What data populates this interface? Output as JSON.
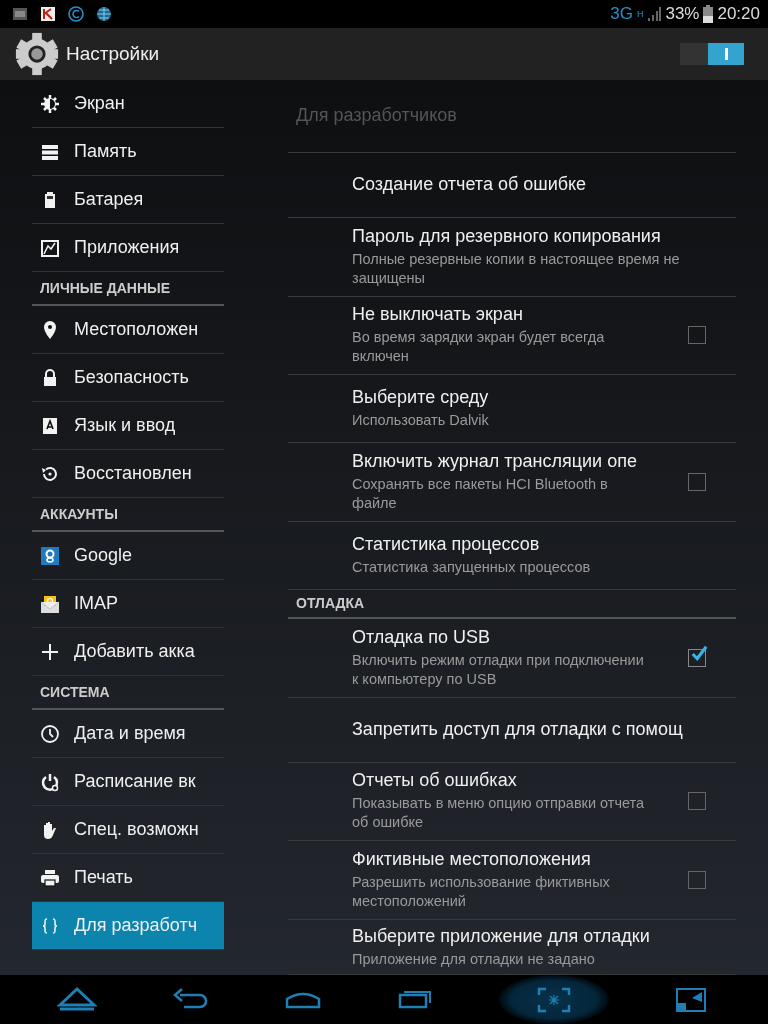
{
  "status_bar": {
    "network": "3G",
    "network_mode": "H",
    "battery": "33%",
    "time": "20:20"
  },
  "action_bar": {
    "title": "Настройки",
    "master_switch": {
      "on": true
    }
  },
  "sidebar": {
    "items": [
      {
        "kind": "item",
        "label": "Экран",
        "selected": false
      },
      {
        "kind": "item",
        "label": "Память",
        "selected": false
      },
      {
        "kind": "item",
        "label": "Батарея",
        "selected": false
      },
      {
        "kind": "item",
        "label": "Приложения",
        "selected": false
      },
      {
        "kind": "header",
        "label": "ЛИЧНЫЕ ДАННЫЕ"
      },
      {
        "kind": "item",
        "label": "Местоположен",
        "selected": false
      },
      {
        "kind": "item",
        "label": "Безопасность",
        "selected": false
      },
      {
        "kind": "item",
        "label": "Язык и ввод",
        "selected": false
      },
      {
        "kind": "item",
        "label": "Восстановлен",
        "selected": false
      },
      {
        "kind": "header",
        "label": "АККАУНТЫ"
      },
      {
        "kind": "item",
        "label": "Google",
        "selected": false
      },
      {
        "kind": "item",
        "label": "IMAP",
        "selected": false
      },
      {
        "kind": "item",
        "label": "Добавить акка",
        "selected": false
      },
      {
        "kind": "header",
        "label": "СИСТЕМА"
      },
      {
        "kind": "item",
        "label": "Дата и время",
        "selected": false
      },
      {
        "kind": "item",
        "label": "Расписание вк",
        "selected": false
      },
      {
        "kind": "item",
        "label": "Спец. возможн",
        "selected": false
      },
      {
        "kind": "item",
        "label": "Печать",
        "selected": false
      },
      {
        "kind": "item",
        "label": "Для разработч",
        "selected": true
      }
    ]
  },
  "content": {
    "title": "Для разработчиков",
    "rows": [
      {
        "kind": "plain",
        "title": "Создание отчета об ошибке"
      },
      {
        "kind": "plain",
        "title": "Пароль для резервного копирования",
        "subtitle": "Полные резервные копии в настоящее время не защищены"
      },
      {
        "kind": "checkbox",
        "title": "Не выключать экран",
        "subtitle": "Во время зарядки экран будет всегда включен",
        "checked": false
      },
      {
        "kind": "plain",
        "title": "Выберите среду",
        "subtitle": "Использовать Dalvik"
      },
      {
        "kind": "checkbox",
        "title": "Включить журнал трансляции опе",
        "subtitle": "Сохранять все пакеты HCI Bluetooth в файле",
        "checked": false
      },
      {
        "kind": "plain",
        "title": "Статистика процессов",
        "subtitle": "Статистика запущенных процессов"
      },
      {
        "kind": "header",
        "title": "ОТЛАДКА"
      },
      {
        "kind": "checkbox",
        "title": "Отладка по USB",
        "subtitle": "Включить режим отладки при подключении к компьютеру по USB",
        "checked": true
      },
      {
        "kind": "plain",
        "title": "Запретить доступ для отладки с помощ"
      },
      {
        "kind": "checkbox",
        "title": "Отчеты об ошибках",
        "subtitle": "Показывать в меню опцию отправки отчета об ошибке",
        "checked": false
      },
      {
        "kind": "checkbox",
        "title": "Фиктивные местоположения",
        "subtitle": "Разрешить использование фиктивных местоположений",
        "checked": false
      },
      {
        "kind": "plain",
        "title": "Выберите приложение для отладки",
        "subtitle": "Приложение для отладки не задано"
      }
    ]
  }
}
